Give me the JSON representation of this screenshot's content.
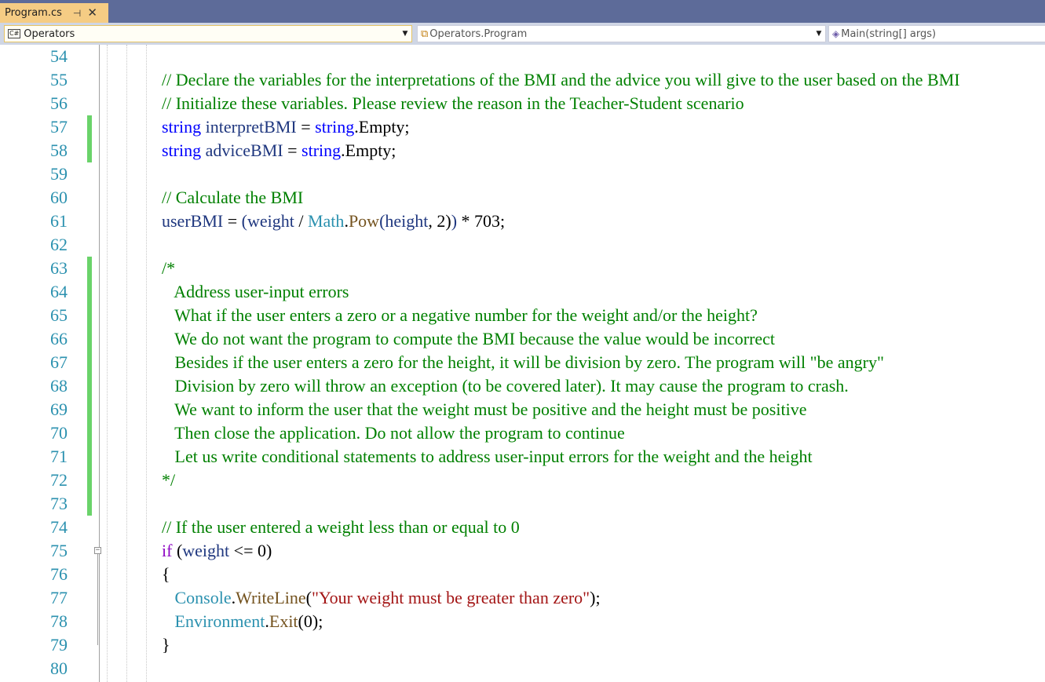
{
  "tab": {
    "filename": "Program.cs",
    "pin_glyph": "⊣",
    "close_glyph": "✕"
  },
  "nav": {
    "project": "Operators",
    "project_icon": "C#",
    "type": "Operators.Program",
    "member": "Main(string[] args)"
  },
  "lines": [
    {
      "n": "54",
      "tokens": []
    },
    {
      "n": "55",
      "tokens": [
        {
          "c": "c",
          "t": "// Declare the variables for the interpretations of the BMI and the advice you will give to the user based on the BMI"
        }
      ]
    },
    {
      "n": "56",
      "tokens": [
        {
          "c": "c",
          "t": "// Initialize these variables. Please review the reason in the Teacher-Student scenario"
        }
      ]
    },
    {
      "n": "57",
      "tokens": [
        {
          "c": "k",
          "t": "string"
        },
        {
          "c": "",
          "t": " "
        },
        {
          "c": "v",
          "t": "interpretBMI"
        },
        {
          "c": "",
          "t": " = "
        },
        {
          "c": "k",
          "t": "string"
        },
        {
          "c": "",
          "t": ".Empty;"
        }
      ]
    },
    {
      "n": "58",
      "tokens": [
        {
          "c": "k",
          "t": "string"
        },
        {
          "c": "",
          "t": " "
        },
        {
          "c": "v",
          "t": "adviceBMI"
        },
        {
          "c": "",
          "t": " = "
        },
        {
          "c": "k",
          "t": "string"
        },
        {
          "c": "",
          "t": ".Empty;"
        }
      ]
    },
    {
      "n": "59",
      "tokens": []
    },
    {
      "n": "60",
      "tokens": [
        {
          "c": "c",
          "t": "// Calculate the BMI"
        }
      ]
    },
    {
      "n": "61",
      "tokens": [
        {
          "c": "v",
          "t": "userBMI"
        },
        {
          "c": "",
          "t": " = "
        },
        {
          "c": "v",
          "t": "("
        },
        {
          "c": "v",
          "t": "weight"
        },
        {
          "c": "",
          "t": " / "
        },
        {
          "c": "t",
          "t": "Math"
        },
        {
          "c": "",
          "t": "."
        },
        {
          "c": "m",
          "t": "Pow"
        },
        {
          "c": "v",
          "t": "("
        },
        {
          "c": "v",
          "t": "height"
        },
        {
          "c": "",
          "t": ", 2)"
        },
        {
          "c": "v",
          "t": ")"
        },
        {
          "c": "",
          "t": " * 703;"
        }
      ]
    },
    {
      "n": "62",
      "tokens": []
    },
    {
      "n": "63",
      "tokens": [
        {
          "c": "c",
          "t": "/*"
        }
      ]
    },
    {
      "n": "64",
      "tokens": [
        {
          "c": "c",
          "t": "   Address user-input errors"
        }
      ]
    },
    {
      "n": "65",
      "tokens": [
        {
          "c": "c",
          "t": "   What if the user enters a zero or a negative number for the weight and/or the height?"
        }
      ]
    },
    {
      "n": "66",
      "tokens": [
        {
          "c": "c",
          "t": "   We do not want the program to compute the BMI because the value would be incorrect"
        }
      ]
    },
    {
      "n": "67",
      "tokens": [
        {
          "c": "c",
          "t": "   Besides if the user enters a zero for the height, it will be division by zero. The program will \"be angry\""
        }
      ]
    },
    {
      "n": "68",
      "tokens": [
        {
          "c": "c",
          "t": "   Division by zero will throw an exception (to be covered later). It may cause the program to crash."
        }
      ]
    },
    {
      "n": "69",
      "tokens": [
        {
          "c": "c",
          "t": "   We want to inform the user that the weight must be positive and the height must be positive"
        }
      ]
    },
    {
      "n": "70",
      "tokens": [
        {
          "c": "c",
          "t": "   Then close the application. Do not allow the program to continue"
        }
      ]
    },
    {
      "n": "71",
      "tokens": [
        {
          "c": "c",
          "t": "   Let us write conditional statements to address user-input errors for the weight and the height"
        }
      ]
    },
    {
      "n": "72",
      "tokens": [
        {
          "c": "c",
          "t": "*/"
        }
      ]
    },
    {
      "n": "73",
      "tokens": []
    },
    {
      "n": "74",
      "tokens": [
        {
          "c": "c",
          "t": "// If the user entered a weight less than or equal to 0"
        }
      ]
    },
    {
      "n": "75",
      "tokens": [
        {
          "c": "kp",
          "t": "if"
        },
        {
          "c": "",
          "t": " ("
        },
        {
          "c": "v",
          "t": "weight"
        },
        {
          "c": "",
          "t": " <= 0)"
        }
      ]
    },
    {
      "n": "76",
      "tokens": [
        {
          "c": "",
          "t": "{"
        }
      ]
    },
    {
      "n": "77",
      "tokens": [
        {
          "c": "",
          "t": "   "
        },
        {
          "c": "t",
          "t": "Console"
        },
        {
          "c": "",
          "t": "."
        },
        {
          "c": "m",
          "t": "WriteLine"
        },
        {
          "c": "",
          "t": "("
        },
        {
          "c": "s",
          "t": "\"Your weight must be greater than zero\""
        },
        {
          "c": "",
          "t": ");"
        }
      ]
    },
    {
      "n": "78",
      "tokens": [
        {
          "c": "",
          "t": "   "
        },
        {
          "c": "t",
          "t": "Environment"
        },
        {
          "c": "",
          "t": "."
        },
        {
          "c": "m",
          "t": "Exit"
        },
        {
          "c": "",
          "t": "(0);"
        }
      ]
    },
    {
      "n": "79",
      "tokens": [
        {
          "c": "",
          "t": "}"
        }
      ]
    },
    {
      "n": "80",
      "tokens": []
    }
  ],
  "changed_line_ranges": [
    [
      "57",
      "58"
    ],
    [
      "63",
      "73"
    ]
  ],
  "collapse_markers": [
    {
      "line": "75",
      "glyph": "−"
    }
  ]
}
